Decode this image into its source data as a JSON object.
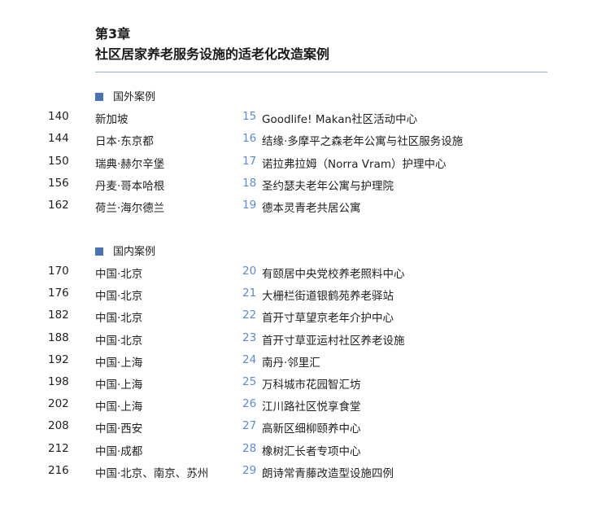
{
  "chapter": {
    "number": "第3章",
    "title": "社区居家养老服务设施的适老化改造案例"
  },
  "colors": {
    "accent": "#4a72b8",
    "case_number": "#5a8ad6",
    "rule": "#9aaecb"
  },
  "foreign": {
    "heading": "国外案例",
    "items": [
      {
        "page": "140",
        "location": "新加坡",
        "number": "15",
        "title": "Goodlife! Makan社区活动中心"
      },
      {
        "page": "144",
        "location": "日本·东京都",
        "number": "16",
        "title": "结缘·多摩平之森老年公寓与社区服务设施"
      },
      {
        "page": "150",
        "location": "瑞典·赫尔辛堡",
        "number": "17",
        "title": "诺拉弗拉姆（Norra Vram）护理中心"
      },
      {
        "page": "156",
        "location": "丹麦·哥本哈根",
        "number": "18",
        "title": "圣约瑟夫老年公寓与护理院"
      },
      {
        "page": "162",
        "location": "荷兰·海尔德兰",
        "number": "19",
        "title": "德本灵青老共居公寓"
      }
    ]
  },
  "domestic": {
    "heading": "国内案例",
    "items": [
      {
        "page": "170",
        "location": "中国·北京",
        "number": "20",
        "title": "有颐居中央党校养老照料中心"
      },
      {
        "page": "176",
        "location": "中国·北京",
        "number": "21",
        "title": "大栅栏街道银鹤苑养老驿站"
      },
      {
        "page": "182",
        "location": "中国·北京",
        "number": "22",
        "title": "首开寸草望京老年介护中心"
      },
      {
        "page": "188",
        "location": "中国·北京",
        "number": "23",
        "title": "首开寸草亚运村社区养老设施"
      },
      {
        "page": "192",
        "location": "中国·上海",
        "number": "24",
        "title": "南丹·邻里汇"
      },
      {
        "page": "198",
        "location": "中国·上海",
        "number": "25",
        "title": "万科城市花园智汇坊"
      },
      {
        "page": "202",
        "location": "中国·上海",
        "number": "26",
        "title": "江川路社区悦享食堂"
      },
      {
        "page": "208",
        "location": "中国·西安",
        "number": "27",
        "title": "高新区细柳颐养中心"
      },
      {
        "page": "212",
        "location": "中国·成都",
        "number": "28",
        "title": "橡树汇长者专项中心"
      },
      {
        "page": "216",
        "location": "中国·北京、南京、苏州",
        "number": "29",
        "title": "朗诗常青藤改造型设施四例"
      }
    ]
  }
}
